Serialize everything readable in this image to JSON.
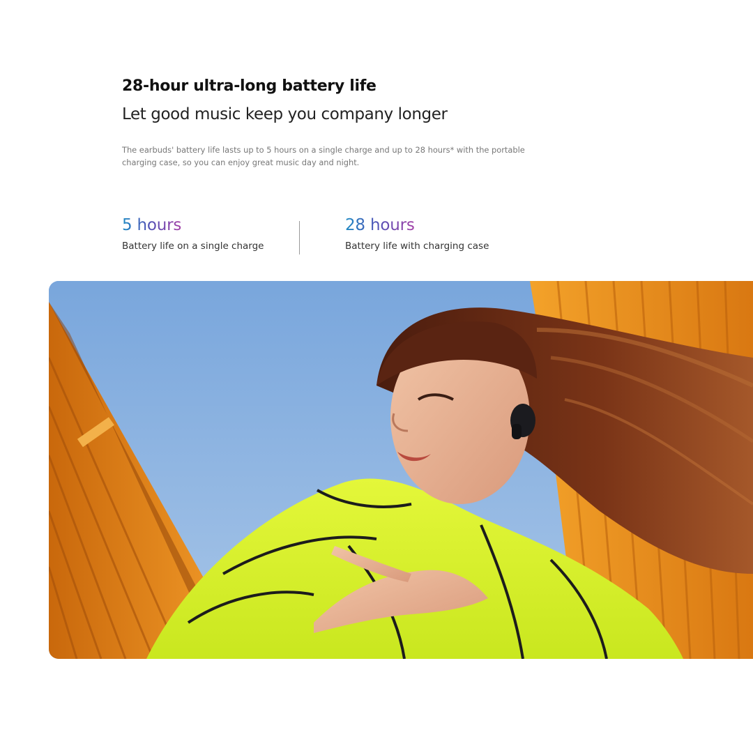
{
  "section": {
    "headline": "28-hour ultra-long battery life",
    "subheadline": "Let good music keep you company longer",
    "description": "The earbuds' battery life lasts up to 5 hours on a single charge and up to 28 hours* with the portable charging case, so you can enjoy great music day and night."
  },
  "stats": [
    {
      "value": "5 hours",
      "label": "Battery life on a single charge"
    },
    {
      "value": "28 hours",
      "label": "Battery life with charging case"
    }
  ],
  "colors": {
    "stat_gradient_start": "#1f8bc4",
    "stat_gradient_mid": "#4f52b6",
    "stat_gradient_end": "#a340a7",
    "sky": "#6f9ed6",
    "jacket": "#d8f22a",
    "building": "#e88a1c"
  },
  "photo": {
    "icon": "earbuds-lifestyle-photo"
  }
}
